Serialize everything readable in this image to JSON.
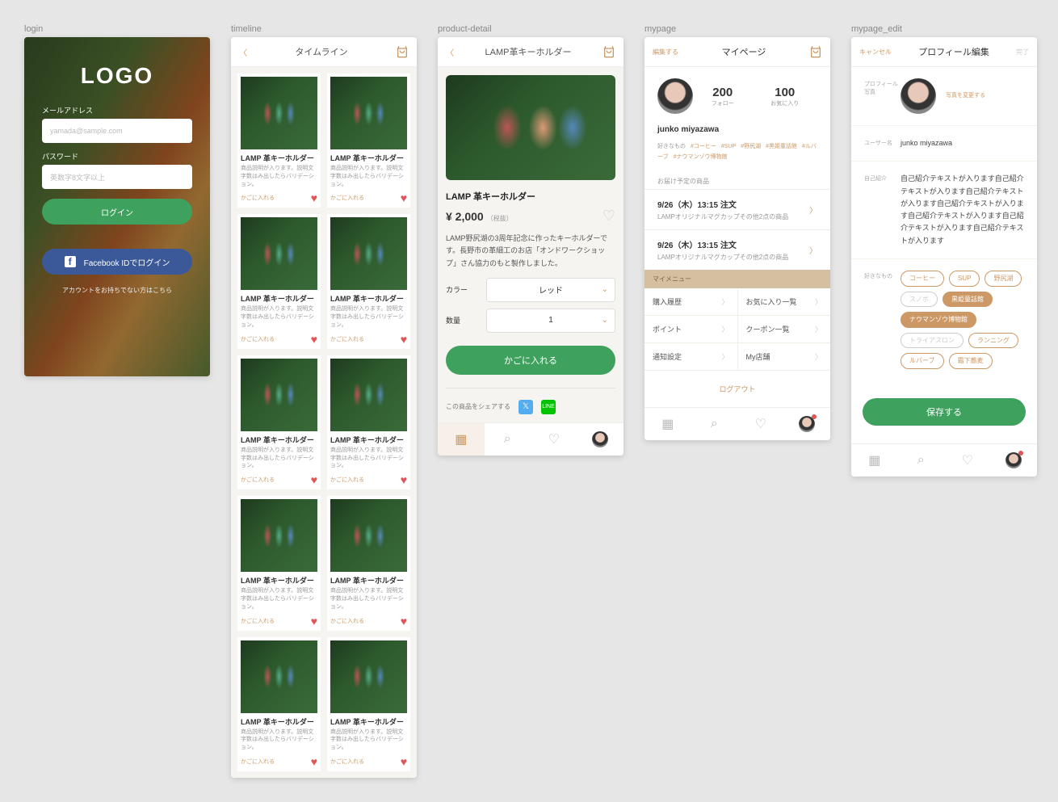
{
  "labels": {
    "login": "login",
    "timeline": "timeline",
    "product": "product-detail",
    "mypage": "mypage",
    "mypage_edit": "mypage_edit"
  },
  "login": {
    "logo": "LOGO",
    "email_label": "メールアドレス",
    "email_ph": "yamada@sample.com",
    "pw_label": "パスワード",
    "pw_ph": "英数字8文字以上",
    "login_btn": "ログイン",
    "fb_btn": "Facebook IDでログイン",
    "foot": "アカウントをお持ちでない方はこちら"
  },
  "timeline": {
    "title": "タイムライン",
    "card": {
      "title": "LAMP 革キーホルダー",
      "desc": "商品説明が入ります。説明文字数はみ出したらバリデーション。",
      "add": "かごに入れる"
    }
  },
  "product": {
    "title": "LAMP革キーホルダー",
    "name": "LAMP 革キーホルダー",
    "price": "¥ 2,000",
    "tax": "（税抜）",
    "desc": "LAMP野尻湖の3周年記念に作ったキーホルダーです。長野市の革細工のお店「オンドワークショップ」さん協力のもと製作しました。",
    "color_l": "カラー",
    "color_v": "レッド",
    "qty_l": "数量",
    "qty_v": "1",
    "add_btn": "かごに入れる",
    "share": "この商品をシェアする"
  },
  "mypage": {
    "edit": "編集する",
    "title": "マイページ",
    "follow_n": "200",
    "follow_l": "フォロー",
    "fav_n": "100",
    "fav_l": "お気に入り",
    "name": "junko miyazawa",
    "tags_l": "好きなもの",
    "tags": [
      "#コーヒー",
      "#SUP",
      "#野尻湖",
      "#黒姫童話館",
      "#ルバーブ",
      "#ナウマンゾウ博物館"
    ],
    "sec": "お届け予定の商品",
    "order_t": "9/26（木）13:15 注文",
    "order_d": "LAMPオリジナルマグカップその他2点の商品",
    "mymenu": "マイメニュー",
    "m1": "購入履歴",
    "m2": "お気に入り一覧",
    "m3": "ポイント",
    "m4": "クーポン一覧",
    "m5": "通知設定",
    "m6": "My店舗",
    "logout": "ログアウト"
  },
  "edit": {
    "cancel": "キャンセル",
    "title": "プロフィール編集",
    "done": "完了",
    "photo_l": "プロフィール写真",
    "photo_chg": "写真を変更する",
    "name_l": "ユーザー名",
    "name_v": "junko miyazawa",
    "bio_l": "自己紹介",
    "bio_v": "自己紹介テキストが入ります自己紹介テキストが入ります自己紹介テキストが入ります自己紹介テキストが入ります自己紹介テキストが入ります自己紹介テキストが入ります自己紹介テキストが入ります",
    "tags_l": "好きなもの",
    "chips": [
      {
        "t": "コーヒー",
        "m": ""
      },
      {
        "t": "SUP",
        "m": ""
      },
      {
        "t": "野尻湖",
        "m": ""
      },
      {
        "t": "スノボ",
        "m": "dis"
      },
      {
        "t": "黒姫童話館",
        "m": "fill"
      },
      {
        "t": "ナウマンゾウ博物館",
        "m": "fill"
      },
      {
        "t": "トライアスロン",
        "m": "dis"
      },
      {
        "t": "ランニング",
        "m": ""
      },
      {
        "t": "ルバーブ",
        "m": ""
      },
      {
        "t": "霜下蕎麦",
        "m": ""
      }
    ],
    "save": "保存する"
  }
}
